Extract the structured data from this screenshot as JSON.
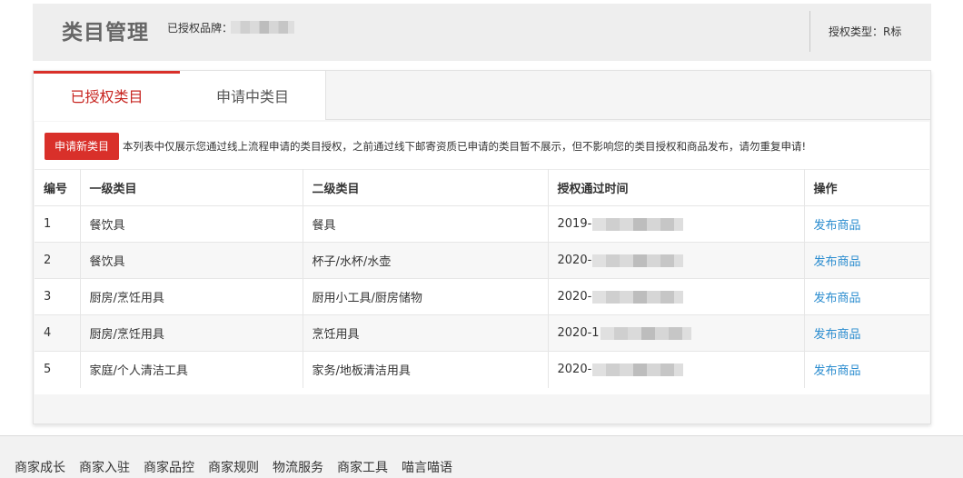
{
  "header": {
    "title": "类目管理",
    "brand_label": "已授权品牌：",
    "auth_type": "授权类型：R标"
  },
  "tabs": [
    {
      "label": "已授权类目",
      "active": true
    },
    {
      "label": "申请中类目",
      "active": false
    }
  ],
  "apply_button": "申请新类目",
  "notice": "本列表中仅展示您通过线上流程申请的类目授权，之前通过线下邮寄资质已申请的类目暂不展示，但不影响您的类目授权和商品发布，请勿重复申请!",
  "table": {
    "columns": [
      "编号",
      "一级类目",
      "二级类目",
      "授权通过时间",
      "操作"
    ],
    "rows": [
      {
        "no": "1",
        "c1": "餐饮具",
        "c2": "餐具",
        "time": "2019-",
        "action": "发布商品"
      },
      {
        "no": "2",
        "c1": "餐饮具",
        "c2": "杯子/水杯/水壶",
        "time": "2020-",
        "action": "发布商品"
      },
      {
        "no": "3",
        "c1": "厨房/烹饪用具",
        "c2": "厨用小工具/厨房储物",
        "time": "2020-",
        "action": "发布商品"
      },
      {
        "no": "4",
        "c1": "厨房/烹饪用具",
        "c2": "烹饪用具",
        "time": "2020-1",
        "action": "发布商品"
      },
      {
        "no": "5",
        "c1": "家庭/个人清洁工具",
        "c2": "家务/地板清洁用具",
        "time": "2020-",
        "action": "发布商品"
      }
    ]
  },
  "footer": {
    "links": [
      "商家成长",
      "商家入驻",
      "商家品控",
      "商家规则",
      "物流服务",
      "商家工具",
      "喵言喵语"
    ]
  }
}
